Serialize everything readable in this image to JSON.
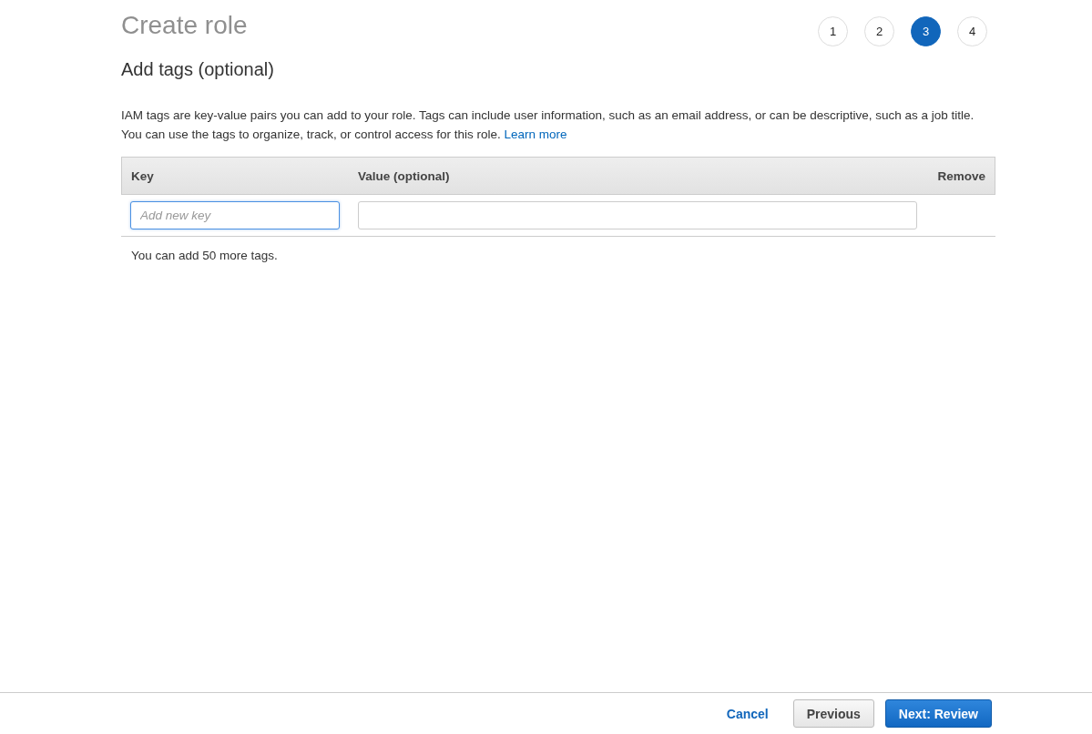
{
  "page_title": "Create role",
  "steps": [
    {
      "label": "1",
      "selected": false
    },
    {
      "label": "2",
      "selected": false
    },
    {
      "label": "3",
      "selected": true
    },
    {
      "label": "4",
      "selected": false
    }
  ],
  "heading": "Add tags (optional)",
  "description": {
    "text": "IAM tags are key-value pairs you can add to your role. Tags can include user information, such as an email address, or can be descriptive, such as a job title. You can use the tags to organize, track, or control access for this role.",
    "link": "Learn more"
  },
  "table": {
    "columns": [
      "Key",
      "Value (optional)",
      "Remove"
    ],
    "rows": [
      {
        "key": {
          "placeholder": "Add new key",
          "focused": true
        },
        "value": {
          "focused": false
        }
      }
    ]
  },
  "remaining_note": "You can add 50 more tags.",
  "footer": {
    "cancel": "Cancel",
    "previous": "Previous",
    "next": "Next: Review"
  }
}
